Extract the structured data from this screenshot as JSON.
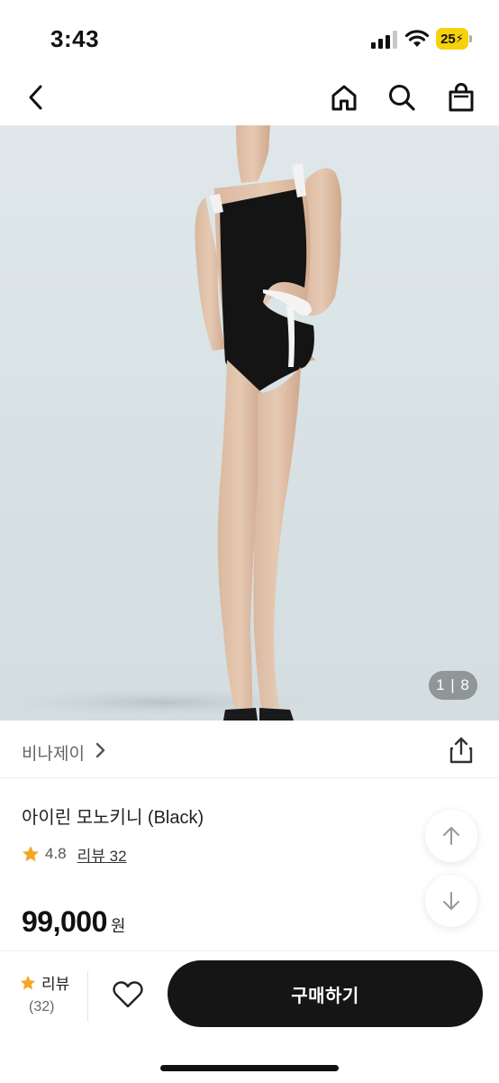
{
  "status_bar": {
    "time": "3:43",
    "battery": "25"
  },
  "nav": {
    "back_icon": "chevron-left-icon",
    "home_icon": "home-icon",
    "search_icon": "search-icon",
    "bag_icon": "shopping-bag-icon"
  },
  "gallery": {
    "current": "1",
    "total": "8",
    "indicator": "1 | 8"
  },
  "brand": {
    "name": "비나제이"
  },
  "product": {
    "title": "아이린 모노키니 (Black)",
    "rating": "4.8",
    "review_link": "리뷰 32",
    "price": "99,000",
    "currency": "원"
  },
  "bottom_bar": {
    "review_label": "리뷰",
    "review_count": "(32)",
    "buy_label": "구매하기"
  },
  "colors": {
    "accent_star": "#f5a623",
    "buy_button": "#151515",
    "battery": "#f5d20a"
  }
}
